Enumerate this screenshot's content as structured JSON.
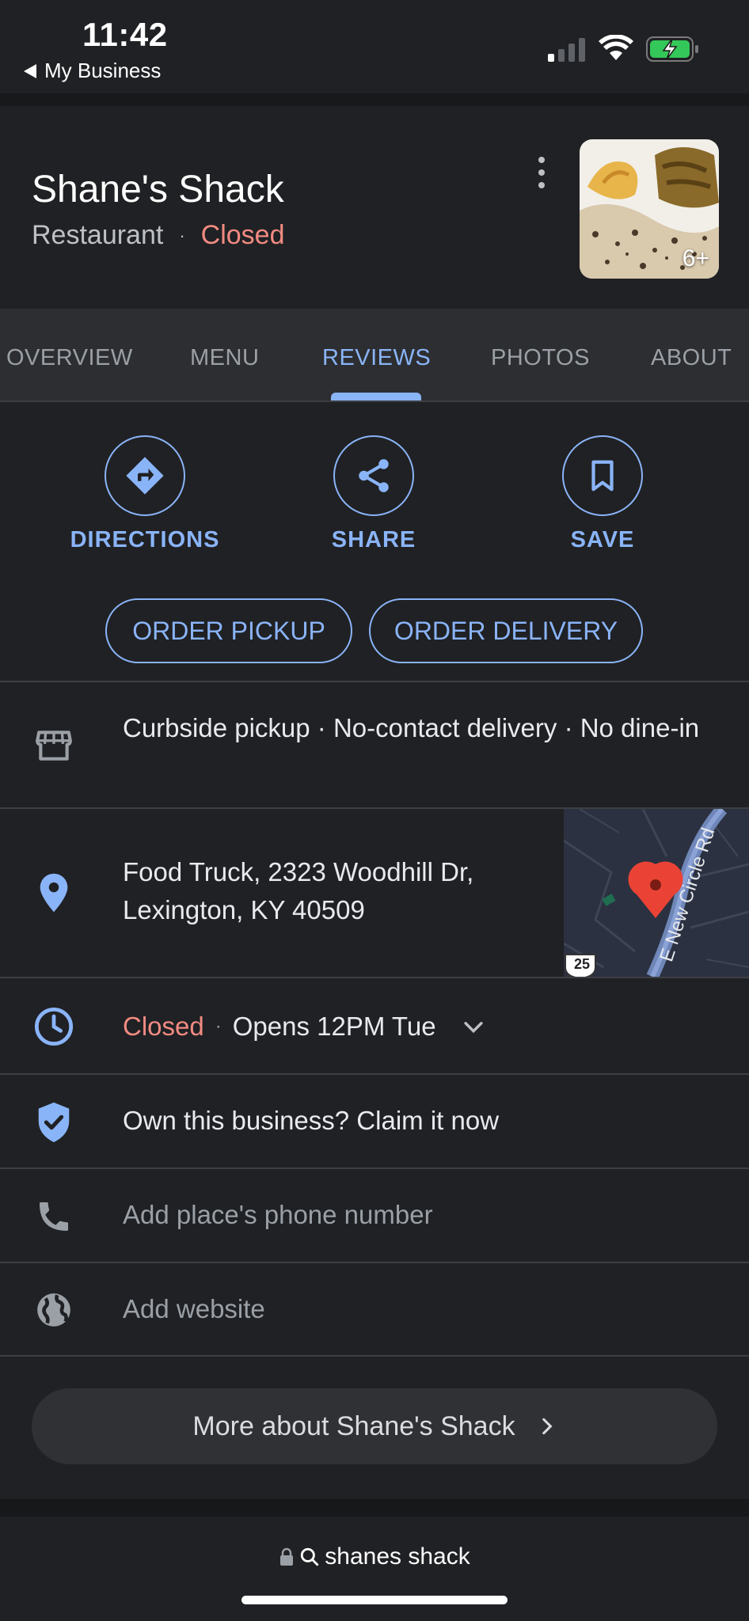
{
  "status_bar": {
    "time": "11:42",
    "back_app": "My Business"
  },
  "place": {
    "name": "Shane's Shack",
    "category": "Restaurant",
    "separator": "·",
    "status": "Closed",
    "photo_count": "6+"
  },
  "tabs": [
    {
      "label": "OVERVIEW",
      "active": false
    },
    {
      "label": "MENU",
      "active": false
    },
    {
      "label": "REVIEWS",
      "active": true
    },
    {
      "label": "PHOTOS",
      "active": false
    },
    {
      "label": "ABOUT",
      "active": false
    }
  ],
  "actions": {
    "directions": "DIRECTIONS",
    "share": "SHARE",
    "save": "SAVE",
    "order_pickup": "ORDER PICKUP",
    "order_delivery": "ORDER DELIVERY"
  },
  "info": {
    "service_options": "Curbside pickup · No-contact delivery · No dine-in",
    "address_line1": "Food Truck, 2323 Woodhill Dr,",
    "address_line2": "Lexington, KY 40509",
    "map_road": "E New Circle Rd",
    "map_route": "25",
    "hours_status": "Closed",
    "hours_sep": "·",
    "hours_next": "Opens 12PM Tue",
    "claim": "Own this business? Claim it now",
    "phone_placeholder": "Add place's phone number",
    "website_placeholder": "Add website"
  },
  "more_button": "More about Shane's Shack",
  "url_bar": {
    "query": "shanes shack"
  },
  "colors": {
    "accent": "#8ab4f8",
    "closed": "#f28b82",
    "background": "#202124"
  },
  "icons": [
    "signal-icon",
    "wifi-icon",
    "battery-charging-icon",
    "more-vert-icon",
    "directions-icon",
    "share-icon",
    "bookmark-icon",
    "storefront-icon",
    "location-pin-icon",
    "clock-icon",
    "chevron-down-icon",
    "verified-shield-icon",
    "phone-icon",
    "globe-icon",
    "chevron-right-icon",
    "lock-icon",
    "search-icon"
  ]
}
